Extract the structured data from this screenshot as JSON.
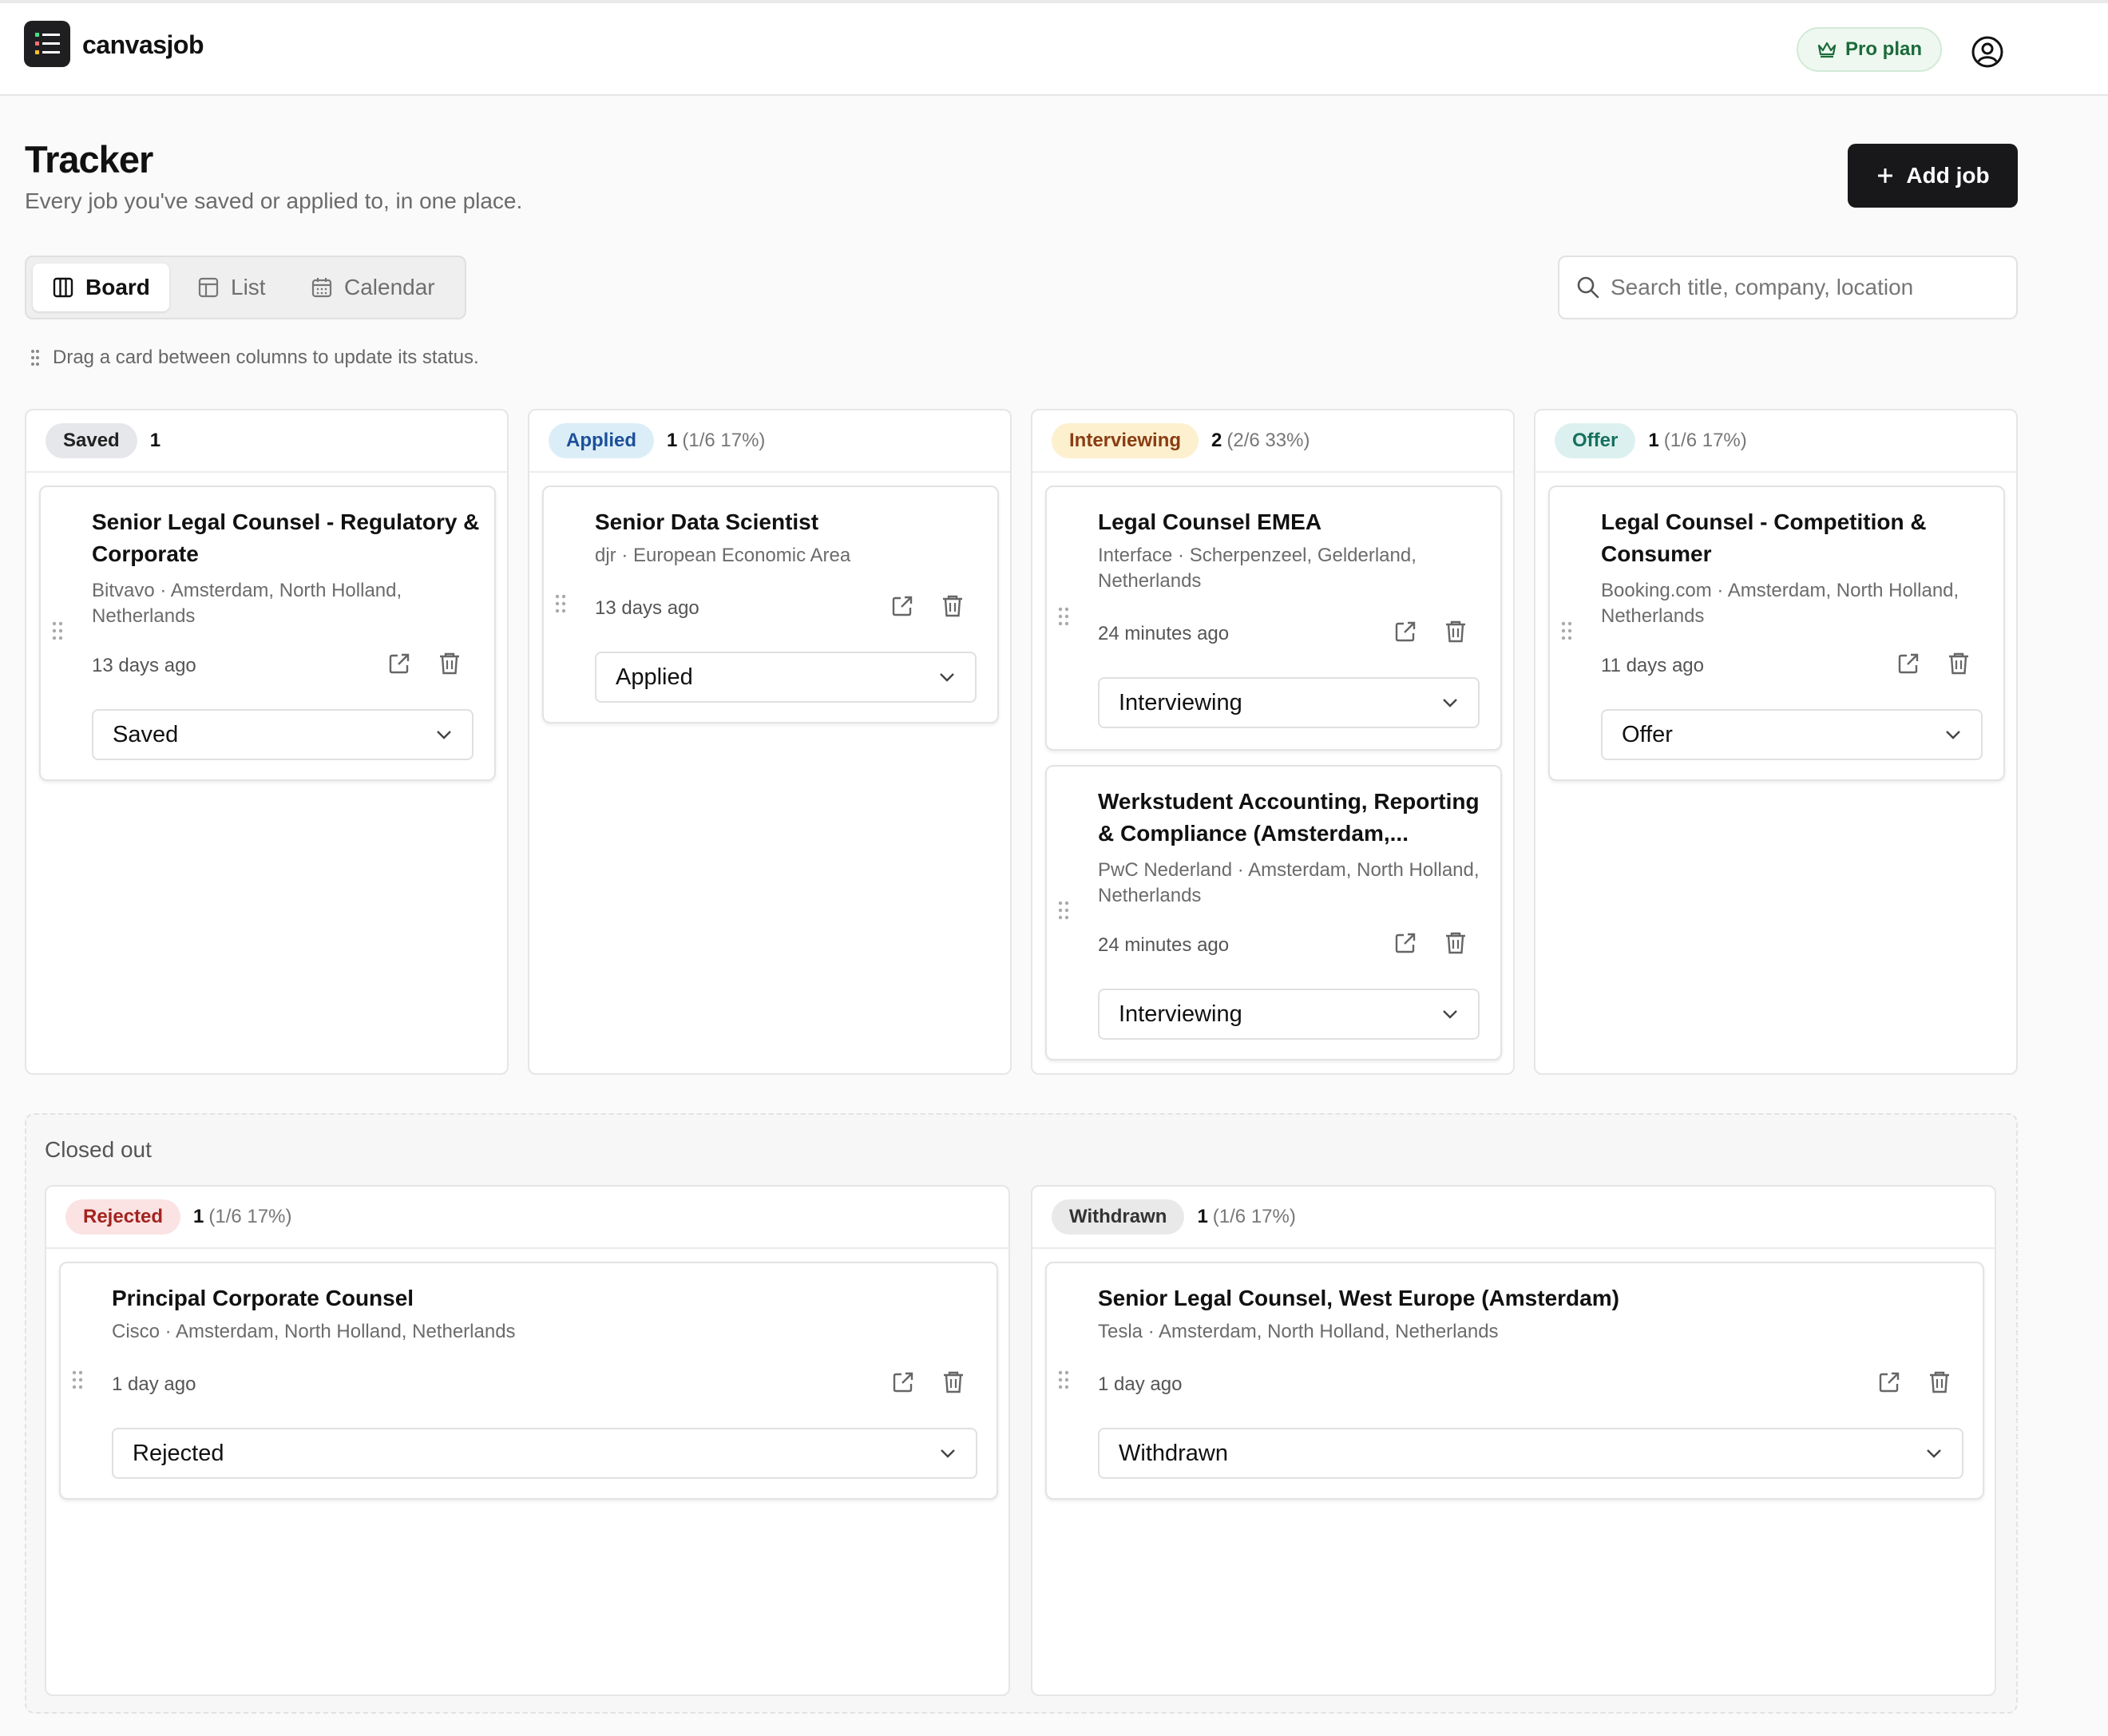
{
  "app": {
    "brand": "canvasjob",
    "plan_label": "Pro plan"
  },
  "page": {
    "title": "Tracker",
    "subtitle": "Every job you've saved or applied to, in one place.",
    "add_job_label": "Add job"
  },
  "views": {
    "board": "Board",
    "list": "List",
    "calendar": "Calendar",
    "active": "Board"
  },
  "search": {
    "placeholder": "Search title, company, location",
    "value": ""
  },
  "hint": "Drag a card between columns to update its status.",
  "columns": [
    {
      "status": "Saved",
      "count": "1",
      "pct": "",
      "color": "#e5e7eb",
      "text_color": "#222222",
      "cards": [
        {
          "title": "Senior Legal Counsel - Regulatory & Corporate",
          "meta": "Bitvavo · Amsterdam, North Holland, Netherlands",
          "time": "13 days ago",
          "status": "Saved"
        }
      ]
    },
    {
      "status": "Applied",
      "count": "1",
      "pct": "(1/6 17%)",
      "color": "#dbeef7",
      "text_color": "#1d4f9a",
      "cards": [
        {
          "title": "Senior Data Scientist",
          "meta": "djr · European Economic Area",
          "time": "13 days ago",
          "status": "Applied"
        }
      ]
    },
    {
      "status": "Interviewing",
      "count": "2",
      "pct": "(2/6 33%)",
      "color": "#fdf0cf",
      "text_color": "#8a3d12",
      "cards": [
        {
          "title": "Legal Counsel EMEA",
          "meta": "Interface · Scherpenzeel, Gelderland, Netherlands",
          "time": "24 minutes ago",
          "status": "Interviewing"
        },
        {
          "title": "Werkstudent Accounting, Reporting & Compliance (Amsterdam,...",
          "meta": "PwC Nederland · Amsterdam, North Holland, Netherlands",
          "time": "24 minutes ago",
          "status": "Interviewing"
        }
      ]
    },
    {
      "status": "Offer",
      "count": "1",
      "pct": "(1/6 17%)",
      "color": "#dcf1ef",
      "text_color": "#17705f",
      "cards": [
        {
          "title": "Legal Counsel - Competition & Consumer",
          "meta": "Booking.com · Amsterdam, North Holland, Netherlands",
          "time": "11 days ago",
          "status": "Offer"
        }
      ]
    }
  ],
  "closed": {
    "label": "Closed out",
    "columns": [
      {
        "status": "Rejected",
        "count": "1",
        "pct": "(1/6 17%)",
        "color": "#fbe3e3",
        "text_color": "#a3231f",
        "cards": [
          {
            "title": "Principal Corporate Counsel",
            "meta": "Cisco · Amsterdam, North Holland, Netherlands",
            "time": "1 day ago",
            "status": "Rejected"
          }
        ]
      },
      {
        "status": "Withdrawn",
        "count": "1",
        "pct": "(1/6 17%)",
        "color": "#e9e9e9",
        "text_color": "#333333",
        "cards": [
          {
            "title": "Senior Legal Counsel, West Europe (Amsterdam)",
            "meta": "Tesla · Amsterdam, North Holland, Netherlands",
            "time": "1 day ago",
            "status": "Withdrawn"
          }
        ]
      }
    ]
  },
  "icons": {
    "logo": "checklist-icon",
    "plan": "crown-icon",
    "account": "user-circle-icon",
    "add": "plus-icon",
    "board": "columns-icon",
    "list": "table-icon",
    "calendar": "calendar-icon",
    "search": "search-icon",
    "drag": "grip-icon",
    "open": "external-link-icon",
    "delete": "trash-icon",
    "select": "chevron-down-icon"
  }
}
